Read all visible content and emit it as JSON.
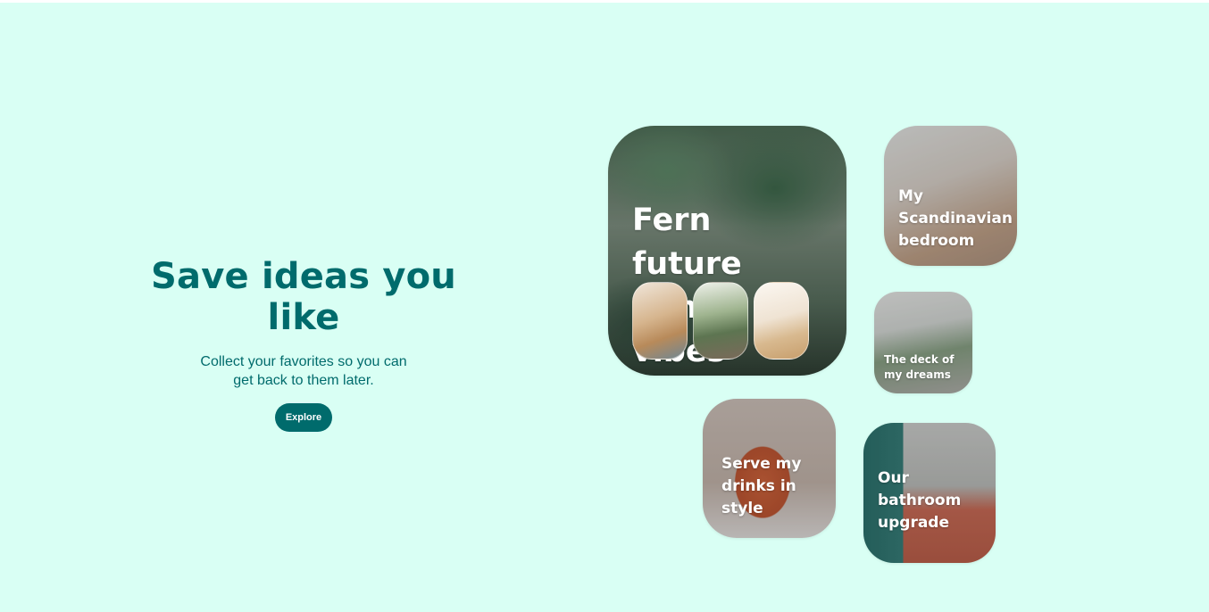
{
  "hero": {
    "heading": "Save ideas you like",
    "subtext": "Collect your favorites so you can get back to them later.",
    "button_label": "Explore"
  },
  "boards": {
    "fern": {
      "title": "Fern future home vibes"
    },
    "scandi": {
      "title": "My Scandinavian bedroom"
    },
    "deck": {
      "title": "The deck of my dreams"
    },
    "drinks": {
      "title": "Serve my drinks in style"
    },
    "bath": {
      "title": "Our bathroom upgrade"
    }
  },
  "colors": {
    "background": "#d9fff4",
    "accent": "#006b6c",
    "card_text": "#ffffff"
  }
}
